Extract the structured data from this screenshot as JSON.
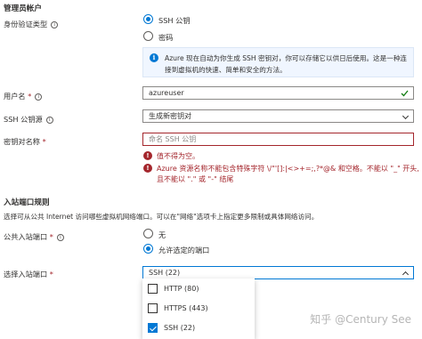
{
  "sections": {
    "admin_account": "管理员帐户",
    "inbound_rules": "入站端口规则"
  },
  "auth_type": {
    "label": "身份验证类型",
    "options": [
      "SSH 公钥",
      "密码"
    ],
    "selected": "SSH 公钥"
  },
  "info_box": {
    "line1": "Azure 现在自动为你生成 SSH 密钥对，你可以存储它以供日后使用。这是一种连",
    "line2": "接到虚拟机的快速、简单和安全的方法。"
  },
  "username": {
    "label": "用户名",
    "required": "*",
    "value": "azureuser"
  },
  "ssh_key_source": {
    "label": "SSH 公钥源",
    "value": "生成新密钥对"
  },
  "key_pair_name": {
    "label": "密钥对名称",
    "required": "*",
    "placeholder": "命名 SSH 公钥",
    "errors": [
      "值不得为空。",
      "Azure 资源名称不能包含特殊字符 \\/\"'[]:|<>+=;,?*@& 和空格。不能以 \"_\" 开头,",
      "且不能以 \".\" 或 \"-\" 结尾"
    ]
  },
  "inbound_desc": "选择可从公共 Internet 访问哪些虚拟机网络端口。可以在\"网络\"选项卡上指定更多限制或具体网络访问。",
  "public_ports": {
    "label": "公共入站端口",
    "required": "*",
    "options": [
      "无",
      "允许选定的端口"
    ],
    "selected": "允许选定的端口"
  },
  "select_ports": {
    "label": "选择入站端口",
    "required": "*",
    "value": "SSH (22)",
    "options": [
      {
        "label": "HTTP (80)",
        "checked": false
      },
      {
        "label": "HTTPS (443)",
        "checked": false
      },
      {
        "label": "SSH (22)",
        "checked": true
      }
    ]
  },
  "watermark": "知乎 @Century See",
  "colors": {
    "accent": "#0078d4",
    "error": "#a4262c",
    "success": "#107c10",
    "info_bg": "#f0f6ff"
  }
}
